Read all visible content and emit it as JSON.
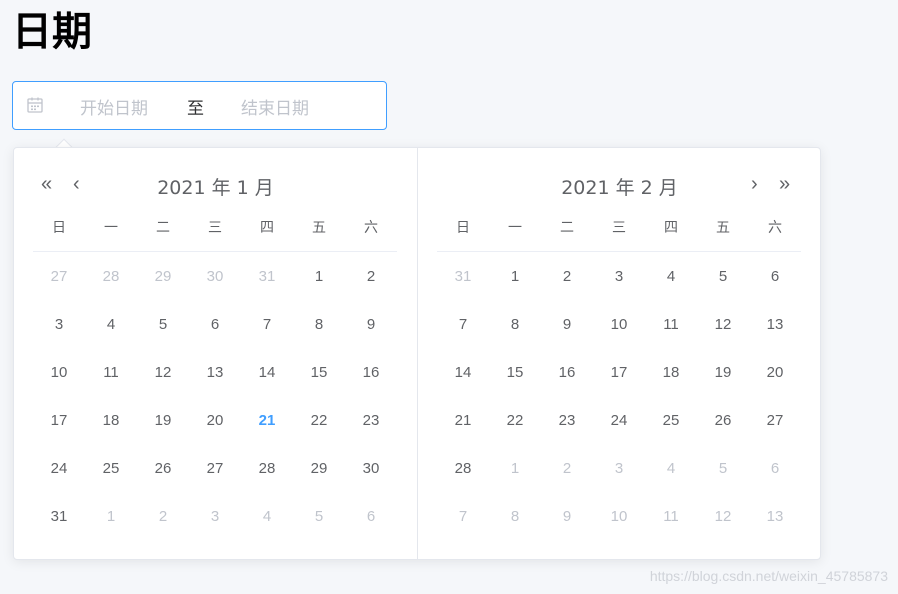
{
  "page": {
    "title": "日期"
  },
  "range_input": {
    "start_placeholder": "开始日期",
    "separator": "至",
    "end_placeholder": "结束日期",
    "icon": "calendar-icon"
  },
  "nav": {
    "prev_year": "«",
    "prev_month": "‹",
    "next_month": "›",
    "next_year": "»"
  },
  "weekdays": [
    "日",
    "一",
    "二",
    "三",
    "四",
    "五",
    "六"
  ],
  "left_month": {
    "header": "2021 年 1 月",
    "weeks": [
      [
        {
          "d": "27",
          "dim": true
        },
        {
          "d": "28",
          "dim": true
        },
        {
          "d": "29",
          "dim": true
        },
        {
          "d": "30",
          "dim": true
        },
        {
          "d": "31",
          "dim": true
        },
        {
          "d": "1"
        },
        {
          "d": "2"
        }
      ],
      [
        {
          "d": "3"
        },
        {
          "d": "4"
        },
        {
          "d": "5"
        },
        {
          "d": "6"
        },
        {
          "d": "7"
        },
        {
          "d": "8"
        },
        {
          "d": "9"
        }
      ],
      [
        {
          "d": "10"
        },
        {
          "d": "11"
        },
        {
          "d": "12"
        },
        {
          "d": "13"
        },
        {
          "d": "14"
        },
        {
          "d": "15"
        },
        {
          "d": "16"
        }
      ],
      [
        {
          "d": "17"
        },
        {
          "d": "18"
        },
        {
          "d": "19"
        },
        {
          "d": "20"
        },
        {
          "d": "21",
          "today": true
        },
        {
          "d": "22"
        },
        {
          "d": "23"
        }
      ],
      [
        {
          "d": "24"
        },
        {
          "d": "25"
        },
        {
          "d": "26"
        },
        {
          "d": "27"
        },
        {
          "d": "28"
        },
        {
          "d": "29"
        },
        {
          "d": "30"
        }
      ],
      [
        {
          "d": "31"
        },
        {
          "d": "1",
          "dim": true
        },
        {
          "d": "2",
          "dim": true
        },
        {
          "d": "3",
          "dim": true
        },
        {
          "d": "4",
          "dim": true
        },
        {
          "d": "5",
          "dim": true
        },
        {
          "d": "6",
          "dim": true
        }
      ]
    ]
  },
  "right_month": {
    "header": "2021 年 2 月",
    "weeks": [
      [
        {
          "d": "31",
          "dim": true
        },
        {
          "d": "1"
        },
        {
          "d": "2"
        },
        {
          "d": "3"
        },
        {
          "d": "4"
        },
        {
          "d": "5"
        },
        {
          "d": "6"
        }
      ],
      [
        {
          "d": "7"
        },
        {
          "d": "8"
        },
        {
          "d": "9"
        },
        {
          "d": "10"
        },
        {
          "d": "11"
        },
        {
          "d": "12"
        },
        {
          "d": "13"
        }
      ],
      [
        {
          "d": "14"
        },
        {
          "d": "15"
        },
        {
          "d": "16"
        },
        {
          "d": "17"
        },
        {
          "d": "18"
        },
        {
          "d": "19"
        },
        {
          "d": "20"
        }
      ],
      [
        {
          "d": "21"
        },
        {
          "d": "22"
        },
        {
          "d": "23"
        },
        {
          "d": "24"
        },
        {
          "d": "25"
        },
        {
          "d": "26"
        },
        {
          "d": "27"
        }
      ],
      [
        {
          "d": "28"
        },
        {
          "d": "1",
          "dim": true
        },
        {
          "d": "2",
          "dim": true
        },
        {
          "d": "3",
          "dim": true
        },
        {
          "d": "4",
          "dim": true
        },
        {
          "d": "5",
          "dim": true
        },
        {
          "d": "6",
          "dim": true
        }
      ],
      [
        {
          "d": "7",
          "dim": true
        },
        {
          "d": "8",
          "dim": true
        },
        {
          "d": "9",
          "dim": true
        },
        {
          "d": "10",
          "dim": true
        },
        {
          "d": "11",
          "dim": true
        },
        {
          "d": "12",
          "dim": true
        },
        {
          "d": "13",
          "dim": true
        }
      ]
    ]
  },
  "colors": {
    "accent": "#409eff",
    "text": "#606266",
    "dim": "#c0c4cc",
    "background": "#f5f7fa"
  },
  "watermark": "https://blog.csdn.net/weixin_45785873"
}
